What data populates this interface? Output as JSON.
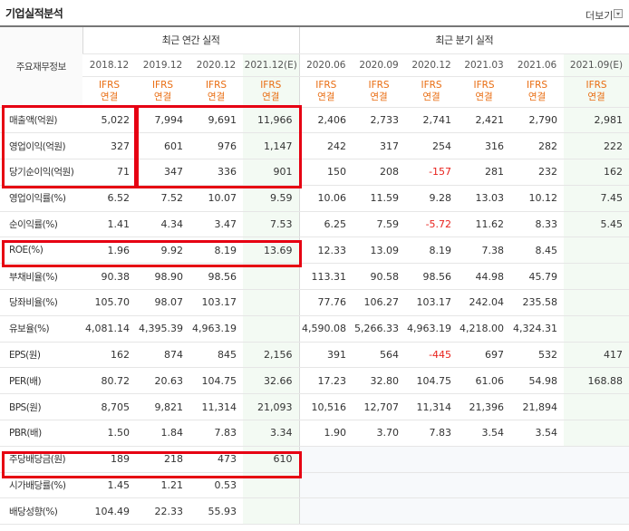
{
  "header": {
    "title": "기업실적분석",
    "more_label": "더보기"
  },
  "table": {
    "corner_label": "주요재무정보",
    "group_annual": "최근 연간 실적",
    "group_quarter": "최근 분기 실적",
    "periods": [
      "2018.12",
      "2019.12",
      "2020.12",
      "2021.12(E)",
      "2020.06",
      "2020.09",
      "2020.12",
      "2021.03",
      "2021.06",
      "2021.09(E)"
    ],
    "basis_top": "IFRS",
    "basis_bottom": "연결",
    "rows": [
      {
        "label": "매출액(억원)",
        "values": [
          "5,022",
          "7,994",
          "9,691",
          "11,966",
          "2,406",
          "2,733",
          "2,741",
          "2,421",
          "2,790",
          "2,981"
        ]
      },
      {
        "label": "영업이익(억원)",
        "values": [
          "327",
          "601",
          "976",
          "1,147",
          "242",
          "317",
          "254",
          "316",
          "282",
          "222"
        ]
      },
      {
        "label": "당기순이익(억원)",
        "values": [
          "71",
          "347",
          "336",
          "901",
          "150",
          "208",
          "-157",
          "281",
          "232",
          "162"
        ]
      },
      {
        "label": "영업이익률(%)",
        "values": [
          "6.52",
          "7.52",
          "10.07",
          "9.59",
          "10.06",
          "11.59",
          "9.28",
          "13.03",
          "10.12",
          "7.45"
        ]
      },
      {
        "label": "순이익률(%)",
        "values": [
          "1.41",
          "4.34",
          "3.47",
          "7.53",
          "6.25",
          "7.59",
          "-5.72",
          "11.62",
          "8.33",
          "5.45"
        ]
      },
      {
        "label": "ROE(%)",
        "values": [
          "1.96",
          "9.92",
          "8.19",
          "13.69",
          "12.33",
          "13.09",
          "8.19",
          "7.38",
          "8.45",
          ""
        ]
      },
      {
        "label": "부채비율(%)",
        "values": [
          "90.38",
          "98.90",
          "98.56",
          "",
          "113.31",
          "90.58",
          "98.56",
          "44.98",
          "45.79",
          ""
        ]
      },
      {
        "label": "당좌비율(%)",
        "values": [
          "105.70",
          "98.07",
          "103.17",
          "",
          "77.76",
          "106.27",
          "103.17",
          "242.04",
          "235.58",
          ""
        ]
      },
      {
        "label": "유보율(%)",
        "values": [
          "4,081.14",
          "4,395.39",
          "4,963.19",
          "",
          "4,590.08",
          "5,266.33",
          "4,963.19",
          "4,218.00",
          "4,324.31",
          ""
        ]
      },
      {
        "label": "EPS(원)",
        "values": [
          "162",
          "874",
          "845",
          "2,156",
          "391",
          "564",
          "-445",
          "697",
          "532",
          "417"
        ]
      },
      {
        "label": "PER(배)",
        "values": [
          "80.72",
          "20.63",
          "104.75",
          "32.66",
          "17.23",
          "32.80",
          "104.75",
          "61.06",
          "54.98",
          "168.88"
        ]
      },
      {
        "label": "BPS(원)",
        "values": [
          "8,705",
          "9,821",
          "11,314",
          "21,093",
          "10,516",
          "12,707",
          "11,314",
          "21,396",
          "21,894",
          ""
        ]
      },
      {
        "label": "PBR(배)",
        "values": [
          "1.50",
          "1.84",
          "7.83",
          "3.34",
          "1.90",
          "3.70",
          "7.83",
          "3.54",
          "3.54",
          ""
        ]
      },
      {
        "label": "주당배당금(원)",
        "values": [
          "189",
          "218",
          "473",
          "610",
          "",
          "",
          "",
          "",
          "",
          ""
        ]
      },
      {
        "label": "시가배당률(%)",
        "values": [
          "1.45",
          "1.21",
          "0.53",
          "",
          "",
          "",
          "",
          "",
          "",
          ""
        ]
      },
      {
        "label": "배당성향(%)",
        "values": [
          "104.49",
          "22.33",
          "55.93",
          "",
          "",
          "",
          "",
          "",
          "",
          ""
        ]
      }
    ]
  },
  "colors": {
    "highlight": "#e60012",
    "basis_text": "#e96d12",
    "negative": "#e8211c",
    "estimate_bg": "#f3faf3"
  }
}
